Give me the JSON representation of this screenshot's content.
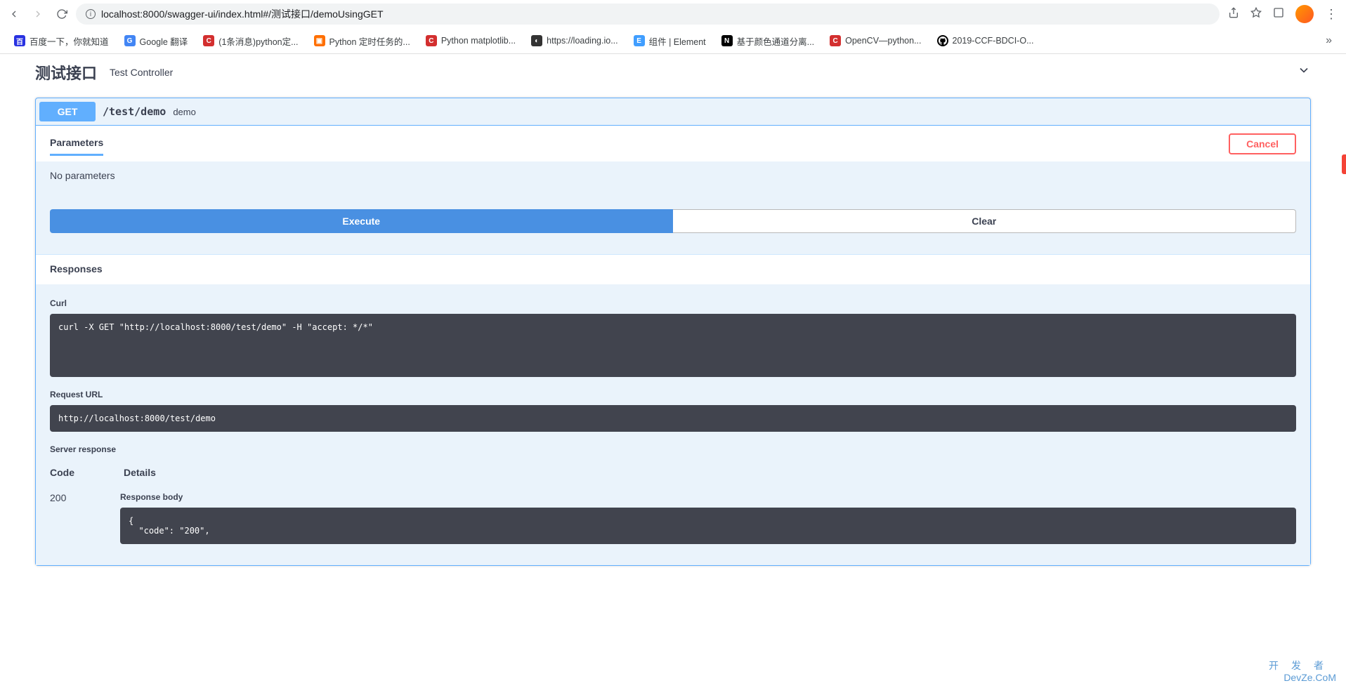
{
  "browser": {
    "url": "localhost:8000/swagger-ui/index.html#/测试接口/demoUsingGET"
  },
  "bookmarks": [
    {
      "label": "百度一下，你就知道"
    },
    {
      "label": "Google 翻译"
    },
    {
      "label": "(1条消息)python定..."
    },
    {
      "label": "Python 定时任务的..."
    },
    {
      "label": "Python matplotlib..."
    },
    {
      "label": "https://loading.io..."
    },
    {
      "label": "组件 | Element"
    },
    {
      "label": "基于颜色通道分离..."
    },
    {
      "label": "OpenCV—python..."
    },
    {
      "label": "2019-CCF-BDCI-O..."
    }
  ],
  "tag": {
    "name": "测试接口",
    "description": "Test Controller"
  },
  "operation": {
    "method": "GET",
    "path": "/test/demo",
    "summary": "demo",
    "parameters_tab": "Parameters",
    "cancel": "Cancel",
    "no_parameters": "No parameters",
    "execute": "Execute",
    "clear": "Clear",
    "responses_title": "Responses"
  },
  "response": {
    "curl_label": "Curl",
    "curl": "curl -X GET \"http://localhost:8000/test/demo\" -H \"accept: */*\"",
    "request_url_label": "Request URL",
    "request_url": "http://localhost:8000/test/demo",
    "server_response_label": "Server response",
    "code_header": "Code",
    "details_header": "Details",
    "code": "200",
    "response_body_label": "Response body",
    "response_body": "{\n  \"code\": \"200\","
  },
  "watermark": {
    "cn": "开发者",
    "en": "DevZe.CoM"
  }
}
